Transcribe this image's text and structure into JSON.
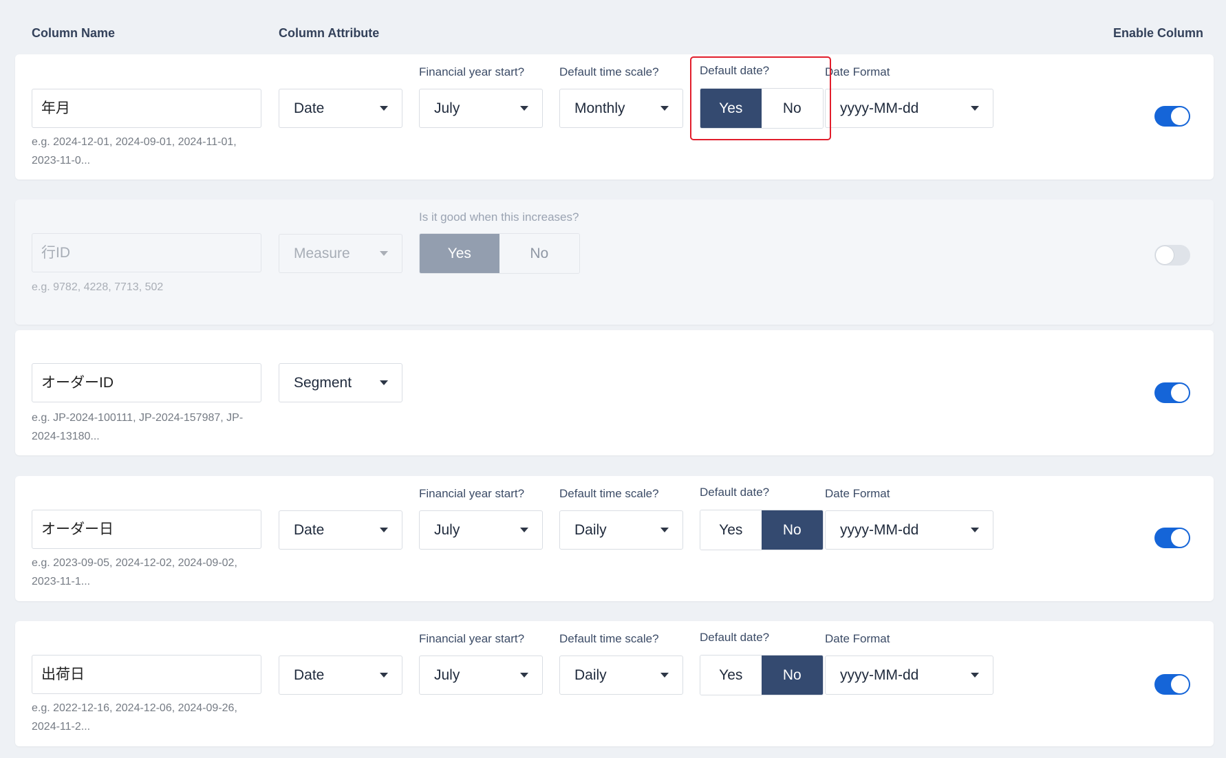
{
  "headers": {
    "column_name": "Column Name",
    "column_attribute": "Column Attribute",
    "enable_column": "Enable Column"
  },
  "colors": {
    "accent": "#344a70",
    "switch_on": "#1565d8",
    "highlight": "#e11d2b"
  },
  "rows": [
    {
      "name": "年月",
      "example": "e.g. 2024-12-01, 2024-09-01, 2024-11-01, 2023-11-0...",
      "attribute": "Date",
      "fy_label": "Financial year start?",
      "fy_value": "July",
      "ts_label": "Default time scale?",
      "ts_value": "Monthly",
      "dd_label": "Default date?",
      "dd_yes": "Yes",
      "dd_no": "No",
      "dd_selected": "Yes",
      "df_label": "Date Format",
      "df_value": "yyyy-MM-dd",
      "enabled": true
    },
    {
      "name": "行ID",
      "example": "e.g. 9782, 4228, 7713, 502",
      "attribute": "Measure",
      "good_label": "Is it good when this increases?",
      "good_yes": "Yes",
      "good_no": "No",
      "good_selected": "Yes",
      "enabled": false
    },
    {
      "name": "オーダーID",
      "example": "e.g. JP-2024-100111, JP-2024-157987, JP-2024-13180...",
      "attribute": "Segment",
      "enabled": true
    },
    {
      "name": "オーダー日",
      "example": "e.g. 2023-09-05, 2024-12-02, 2024-09-02, 2023-11-1...",
      "attribute": "Date",
      "fy_label": "Financial year start?",
      "fy_value": "July",
      "ts_label": "Default time scale?",
      "ts_value": "Daily",
      "dd_label": "Default date?",
      "dd_yes": "Yes",
      "dd_no": "No",
      "dd_selected": "No",
      "df_label": "Date Format",
      "df_value": "yyyy-MM-dd",
      "enabled": true
    },
    {
      "name": "出荷日",
      "example": "e.g. 2022-12-16, 2024-12-06, 2024-09-26, 2024-11-2...",
      "attribute": "Date",
      "fy_label": "Financial year start?",
      "fy_value": "July",
      "ts_label": "Default time scale?",
      "ts_value": "Daily",
      "dd_label": "Default date?",
      "dd_yes": "Yes",
      "dd_no": "No",
      "dd_selected": "No",
      "df_label": "Date Format",
      "df_value": "yyyy-MM-dd",
      "enabled": true
    }
  ]
}
